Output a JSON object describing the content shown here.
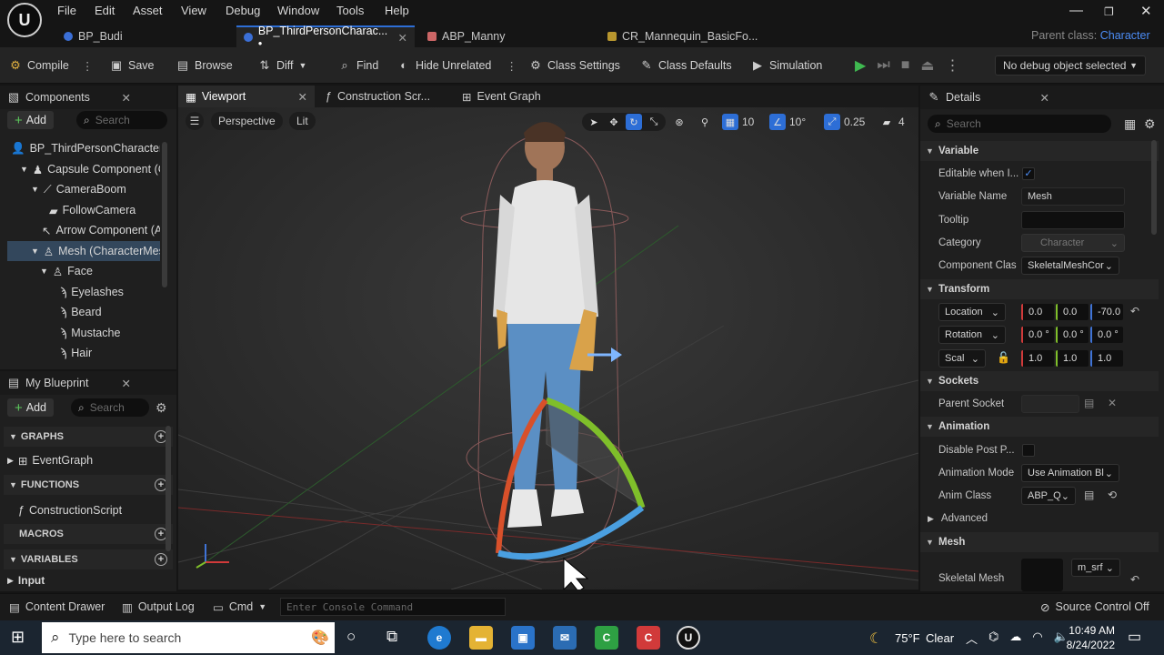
{
  "menu": {
    "items": [
      "File",
      "Edit",
      "Asset",
      "View",
      "Debug",
      "Window",
      "Tools",
      "Help"
    ]
  },
  "doc_tabs": [
    {
      "label": "BP_Budi"
    },
    {
      "label": "BP_ThirdPersonCharac... •"
    },
    {
      "label": "ABP_Manny"
    },
    {
      "label": "CR_Mannequin_BasicFo..."
    }
  ],
  "parent_class": {
    "label": "Parent class:",
    "value": "Character"
  },
  "toolbar": {
    "compile": "Compile",
    "save": "Save",
    "browse": "Browse",
    "diff": "Diff",
    "find": "Find",
    "hide_unrelated": "Hide Unrelated",
    "class_settings": "Class Settings",
    "class_defaults": "Class Defaults",
    "simulation": "Simulation",
    "debug_object": "No debug object selected"
  },
  "components": {
    "title": "Components",
    "add": "Add",
    "search_placeholder": "Search",
    "items": [
      "BP_ThirdPersonCharacter",
      "Capsule Component (C",
      "CameraBoom",
      "FollowCamera",
      "Arrow Component (A",
      "Mesh (CharacterMes",
      "Face",
      "Eyelashes",
      "Beard",
      "Mustache",
      "Hair"
    ]
  },
  "my_blueprint": {
    "title": "My Blueprint",
    "add": "Add",
    "search_placeholder": "Search",
    "graphs": "GRAPHS",
    "event_graph": "EventGraph",
    "functions": "FUNCTIONS",
    "construction_script": "ConstructionScript",
    "macros": "MACROS",
    "variables": "VARIABLES",
    "input": "Input"
  },
  "editor_tabs": [
    "Viewport",
    "Construction Scr...",
    "Event Graph"
  ],
  "viewport": {
    "perspective": "Perspective",
    "lit": "Lit",
    "grid_snap": "10",
    "rot_snap": "10°",
    "scale_snap": "0.25",
    "camera_speed": "4"
  },
  "details": {
    "title": "Details",
    "search_placeholder": "Search",
    "variable": {
      "section": "Variable",
      "editable_label": "Editable when I...",
      "editable_checked": "✓",
      "name_label": "Variable Name",
      "name_value": "Mesh",
      "tooltip_label": "Tooltip",
      "tooltip_value": "",
      "category_label": "Category",
      "category_value": "Character",
      "component_class_label": "Component Clas",
      "component_class_value": "SkeletalMeshCor"
    },
    "transform": {
      "section": "Transform",
      "location": "Location",
      "location_values": [
        "0.0",
        "0.0",
        "-70.0"
      ],
      "rotation": "Rotation",
      "rotation_values": [
        "0.0 °",
        "0.0 °",
        "0.0 °"
      ],
      "scale": "Scal",
      "scale_values": [
        "1.0",
        "1.0",
        "1.0"
      ]
    },
    "sockets": {
      "section": "Sockets",
      "parent_socket": "Parent Socket"
    },
    "animation": {
      "section": "Animation",
      "disable_post": "Disable Post P...",
      "mode_label": "Animation Mode",
      "mode_value": "Use Animation Bl",
      "anim_class_label": "Anim Class",
      "anim_class_value": "ABP_Q",
      "advanced": "Advanced"
    },
    "mesh": {
      "section": "Mesh",
      "skeletal_mesh": "Skeletal Mesh",
      "skeletal_value": "m_srf"
    }
  },
  "statusbar": {
    "content_drawer": "Content Drawer",
    "output_log": "Output Log",
    "cmd": "Cmd",
    "console_placeholder": "Enter Console Command",
    "source_control": "Source Control Off"
  },
  "taskbar": {
    "search_placeholder": "Type here to search",
    "temperature": "75°F",
    "weather": "Clear",
    "time": "10:49 AM",
    "date": "8/24/2022"
  },
  "colors": {
    "accent": "#2d6ed6",
    "selection": "#33475c",
    "panel": "#1f1f1f"
  }
}
